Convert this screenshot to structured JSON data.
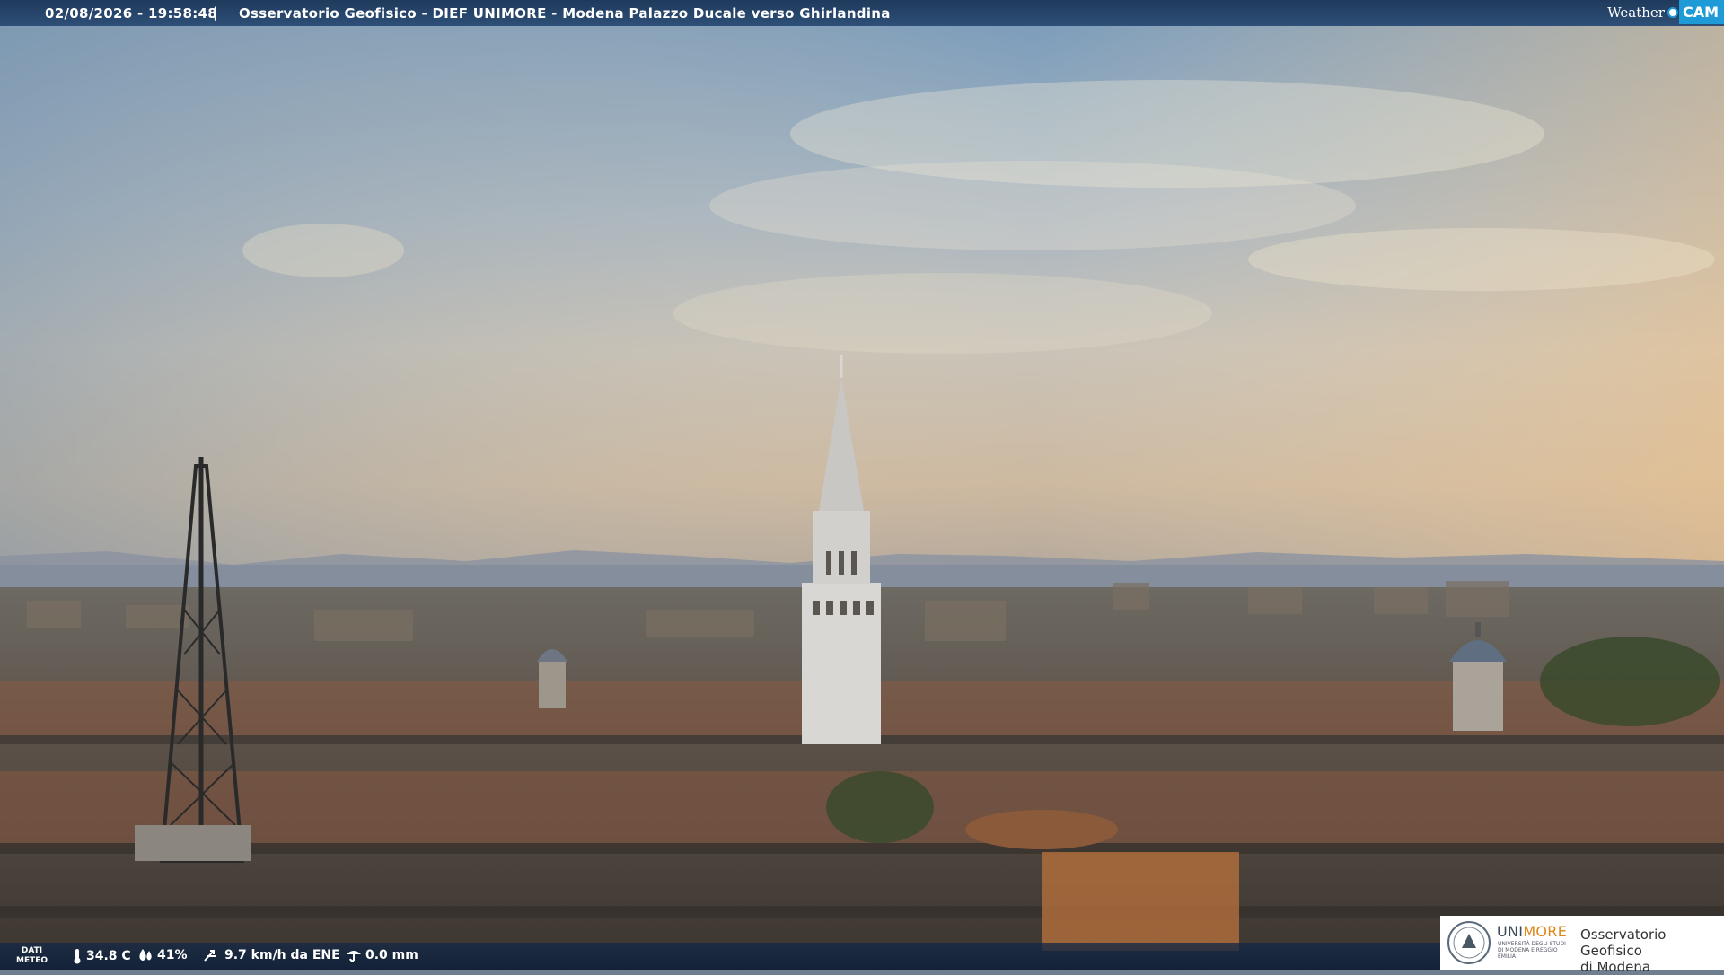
{
  "header": {
    "timestamp": "02/08/2026 - 19:58:48",
    "separator": "|",
    "title": "Osservatorio Geofisico - DIEF UNIMORE - Modena Palazzo Ducale verso Ghirlandina"
  },
  "brand": {
    "weather": "Weather",
    "cam": "CAM",
    "accent": "#1e9ad6"
  },
  "weather_bar": {
    "label_line1": "DATI",
    "label_line2": "METEO",
    "temperature": "34.8 C",
    "humidity": "41%",
    "wind": "9.7 km/h da ENE",
    "rain": "0.0 mm",
    "icons": [
      "thermometer-icon",
      "humidity-drop-icon",
      "wind-icon",
      "rain-gauge-icon"
    ]
  },
  "logo": {
    "uni": "UNI",
    "more": "MORE",
    "sub": "UNIVERSITÀ DEGLI STUDI DI MODENA E REGGIO EMILIA",
    "obs_line1": "Osservatorio Geofisico",
    "obs_line2": "di Modena"
  },
  "colors": {
    "bar": "#1f3a5c",
    "more_orange": "#e0861a"
  }
}
